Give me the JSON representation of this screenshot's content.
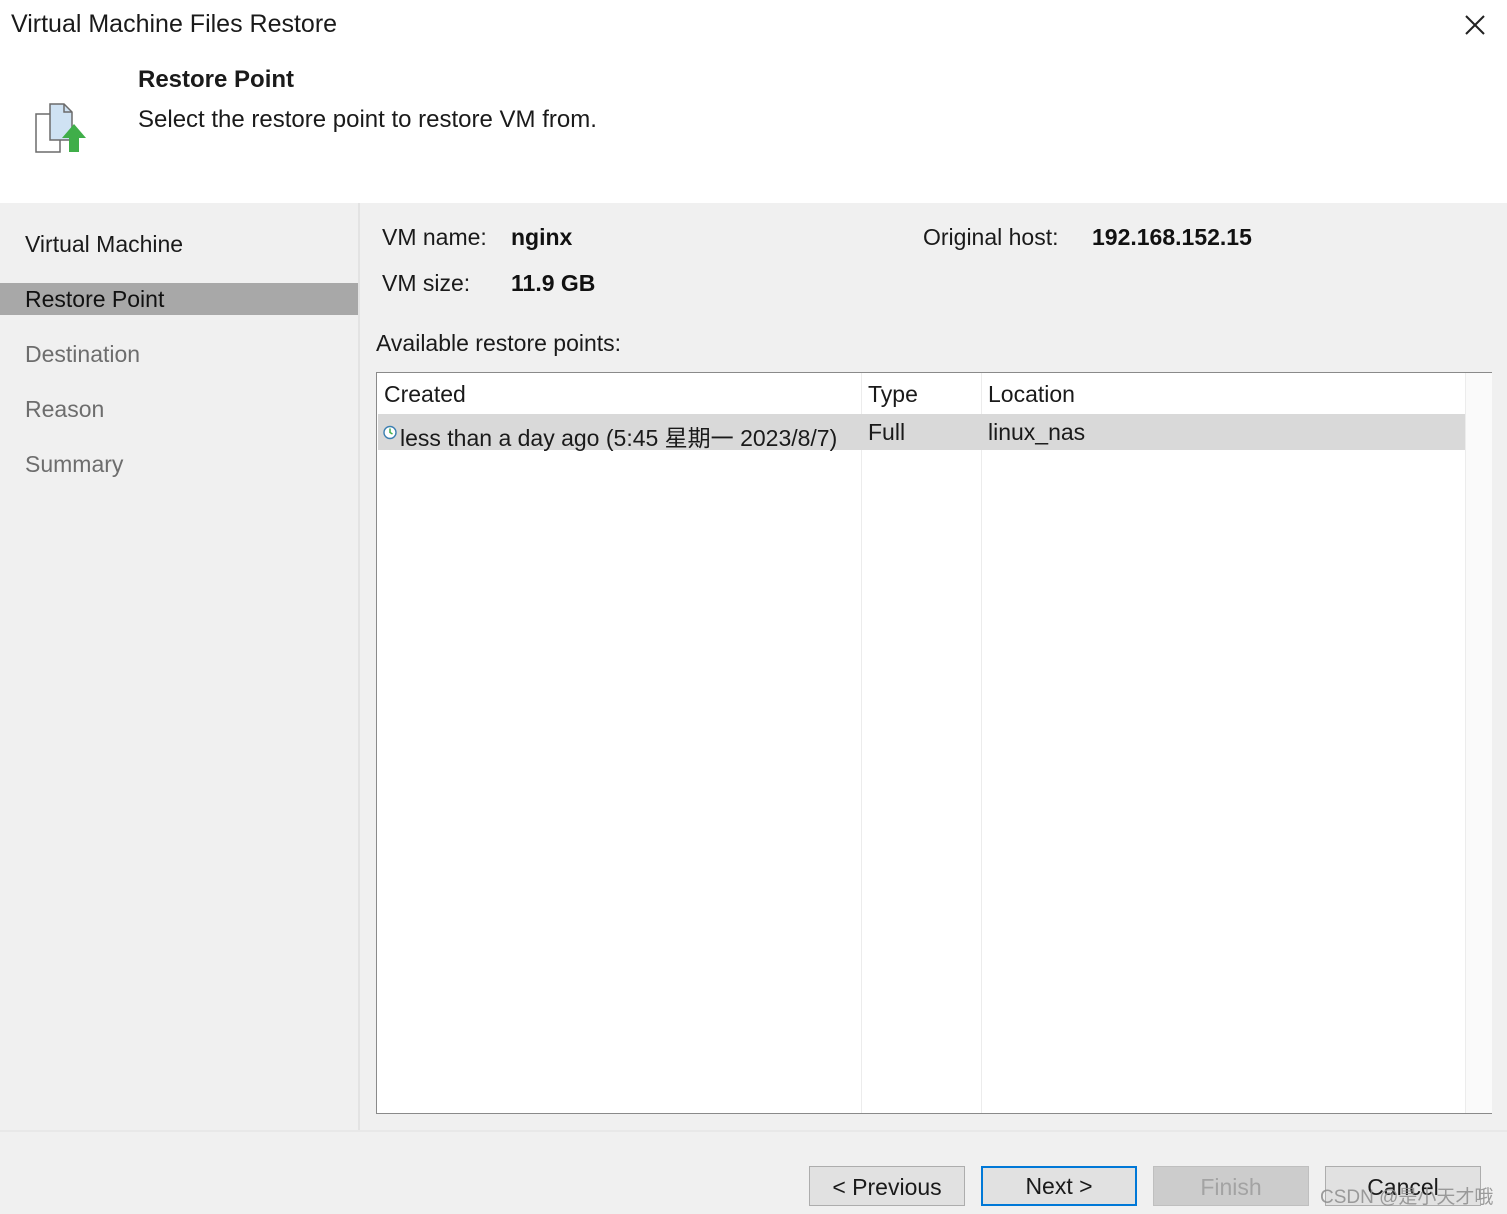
{
  "window": {
    "title": "Virtual Machine Files Restore"
  },
  "header": {
    "title": "Restore Point",
    "description": "Select the restore point to restore VM from."
  },
  "steps": [
    {
      "label": "Virtual Machine",
      "state": "done"
    },
    {
      "label": "Restore Point",
      "state": "active"
    },
    {
      "label": "Destination",
      "state": "pending"
    },
    {
      "label": "Reason",
      "state": "pending"
    },
    {
      "label": "Summary",
      "state": "pending"
    }
  ],
  "vm_info": {
    "name_label": "VM name:",
    "name_value": "nginx",
    "size_label": "VM size:",
    "size_value": "11.9 GB",
    "host_label": "Original host:",
    "host_value": "192.168.152.15"
  },
  "restore_points": {
    "label": "Available restore points:",
    "columns": [
      "Created",
      "Type",
      "Location"
    ],
    "rows": [
      {
        "created": "less than a day ago (5:45 星期一 2023/8/7)",
        "type": "Full",
        "location": "linux_nas",
        "icon": "restore-point-clock-icon"
      }
    ]
  },
  "buttons": {
    "previous": "< Previous",
    "next": "Next >",
    "finish": "Finish",
    "cancel": "Cancel"
  },
  "watermark": "CSDN @是小天才哦",
  "colors": {
    "accent": "#0078d7",
    "active_step": "#a8a8a8",
    "selected_row": "#d9d9d9",
    "pane_bg": "#f0f0f0",
    "icon_green": "#3fae49"
  }
}
